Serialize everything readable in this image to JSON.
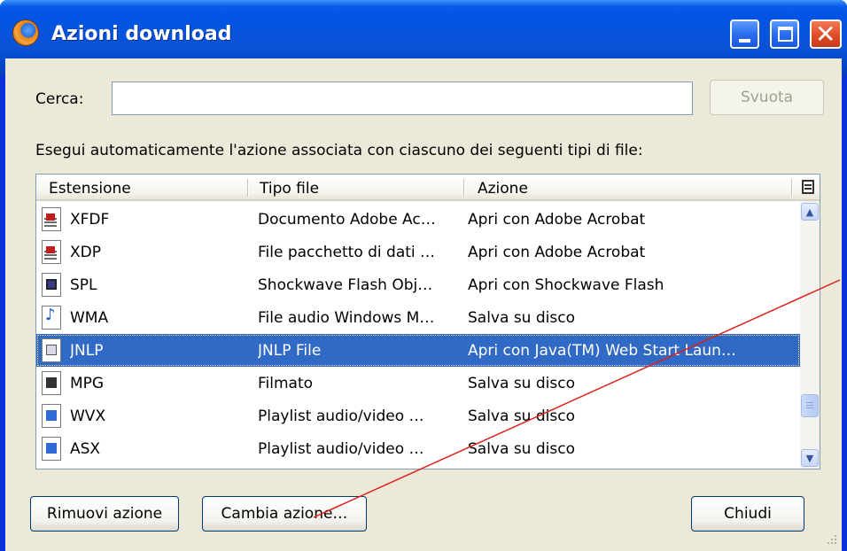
{
  "window": {
    "title": "Azioni download",
    "icon": "firefox-icon",
    "buttons": [
      "minimize-icon",
      "maximize-icon",
      "close-icon"
    ]
  },
  "search": {
    "label": "Cerca:",
    "value": "",
    "clear_label": "Svuota"
  },
  "description": "Esegui automaticamente l'azione associata con ciascuno dei seguenti tipi di file:",
  "table": {
    "columns": [
      "Estensione",
      "Tipo file",
      "Azione"
    ],
    "rows": [
      {
        "icon": "pdf-file-icon",
        "ext": "XFDF",
        "type": "Documento Adobe Ac…",
        "action": "Apri con Adobe Acrobat"
      },
      {
        "icon": "pdf-file-icon",
        "ext": "XDP",
        "type": "File pacchetto di dati …",
        "action": "Apri con Adobe Acrobat"
      },
      {
        "icon": "flash-file-icon",
        "ext": "SPL",
        "type": "Shockwave Flash Obj…",
        "action": "Apri con Shockwave Flash"
      },
      {
        "icon": "audio-file-icon",
        "ext": "WMA",
        "type": "File audio Windows M…",
        "action": "Salva su disco"
      },
      {
        "icon": "java-file-icon",
        "ext": "JNLP",
        "type": "JNLP File",
        "action": "Apri con Java(TM) Web Start Laun…",
        "selected": true
      },
      {
        "icon": "video-file-icon",
        "ext": "MPG",
        "type": "Filmato",
        "action": "Salva su disco"
      },
      {
        "icon": "playlist-file-icon",
        "ext": "WVX",
        "type": "Playlist audio/video …",
        "action": "Salva su disco"
      },
      {
        "icon": "playlist-file-icon",
        "ext": "ASX",
        "type": "Playlist audio/video …",
        "action": "Salva su disco"
      }
    ]
  },
  "footer": {
    "remove_label": "Rimuovi azione",
    "change_label": "Cambia azione…",
    "close_label": "Chiudi"
  },
  "colors": {
    "titlebar": "#0054e3",
    "selection": "#316ac5",
    "annotation_line": "#e0201a"
  }
}
